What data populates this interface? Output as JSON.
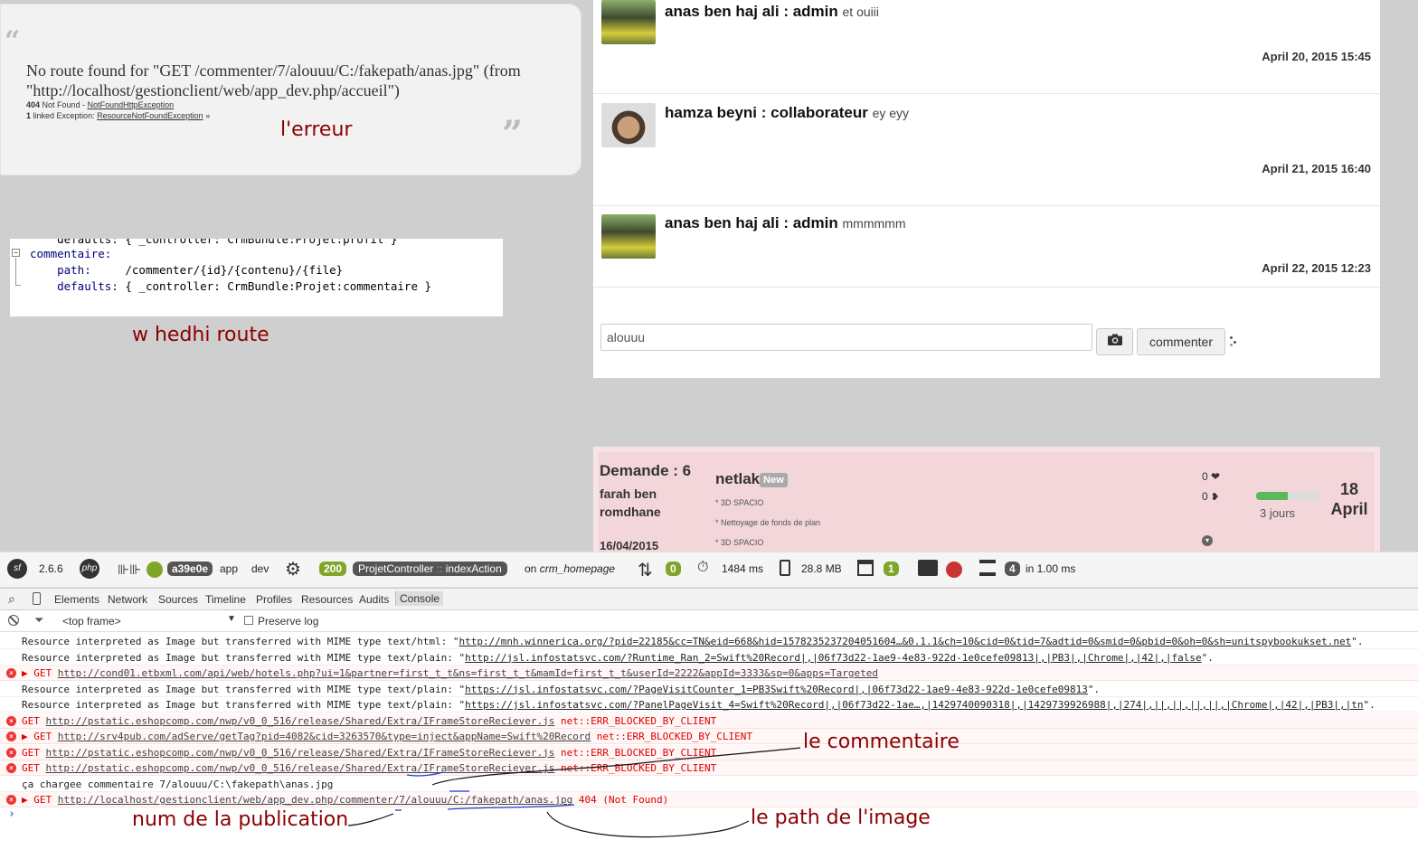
{
  "error_panel": {
    "message": "No route found for \"GET /commenter/7/alouuu/C:/fakepath/anas.jpg\" (from \"http://localhost/gestionclient/web/app_dev.php/accueil\")",
    "status_code": "404",
    "status_text": "Not Found - ",
    "exception1": "NotFoundHttpException",
    "linked_count": "1",
    "linked_label": "linked Exception:",
    "exception2": "ResourceNotFoundException",
    "chevron": "»",
    "annotation": "l'erreur"
  },
  "route_code": {
    "line0": "    defaults: { _controller: CrmBundle:Projet:profil }",
    "line1": "commentaire:",
    "line2_key": "    path:",
    "line2_val": "     /commenter/{id}/{contenu}/{file}",
    "line3_key": "    defaults:",
    "line3_val": " { _controller: CrmBundle:Projet:commentaire }",
    "annotation": "w hedhi route"
  },
  "comments": [
    {
      "author": "anas ben haj ali : admin",
      "text": "et ouiii",
      "date": "April 20, 2015 15:45"
    },
    {
      "author": "hamza beyni : collaborateur",
      "text": "ey eyy",
      "date": "April 21, 2015 16:40"
    },
    {
      "author": "anas ben haj ali : admin",
      "text": "mmmmmm",
      "date": "April 22, 2015 12:23"
    }
  ],
  "comment_form": {
    "input_value": "alouuu",
    "button_label": "commenter"
  },
  "demande": {
    "title": "Demande : 6",
    "client_line1": "farah ben",
    "client_line2": "romdhane",
    "date": "16/04/2015",
    "name": "netlak",
    "badge": "New",
    "items": [
      "* 3D SPACIO",
      "* Nettoyage de fonds de plan",
      "* 3D SPACIO"
    ],
    "likes": "0",
    "dislikes": "0",
    "progress": 0.5,
    "days_label": "3 jours",
    "day": "18",
    "month": "April"
  },
  "symfony_bar": {
    "version": "2.6.6",
    "php": "php",
    "token": "a39e0e",
    "env_app": "app",
    "env_dev": "dev",
    "status": "200",
    "controller": "ProjetController",
    "sep": "::",
    "action": "indexAction",
    "route_prefix": "on",
    "route": "crm_homepage",
    "ajax_count": "0",
    "time": "1484 ms",
    "memory": "28.8 MB",
    "logs_count": "1",
    "db_count": "4",
    "db_time": "in 1.00 ms"
  },
  "devtools": {
    "tabs": [
      "Elements",
      "Network",
      "Sources",
      "Timeline",
      "Profiles",
      "Resources",
      "Audits",
      "Console"
    ],
    "frame": "<top frame>",
    "preserve_log": "Preserve log",
    "prompt": "›",
    "rows": [
      {
        "type": "info",
        "text": "Resource interpreted as Image but transferred with MIME type text/html: \"",
        "url": "http://mnh.winnerica.org/?pid=22185&cc=TN&eid=668&hid=1578235237204051604…&0.1.1&ch=10&cid=0&tid=7&adtid=0&smid=0&pbid=0&oh=0&sh=unitspybookukset.net",
        "tail": "\"."
      },
      {
        "type": "info",
        "text": "Resource interpreted as Image but transferred with MIME type text/plain: \"",
        "url": "http://jsl.infostatsvc.com/?Runtime_Ran_2=Swift%20Record|,|06f73d22-1ae9-4e83-922d-1e0cefe09813|,|PB3|,|Chrome|,|42|,|false",
        "tail": "\"."
      },
      {
        "type": "err",
        "text": "▶ GET ",
        "url": "http://cond01.etbxml.com/api/web/hotels.php?ui=1&partner=first_t_t&ns=first_t_t&mamId=first_t_t&userId=2222&appId=3333&sp=0&apps=Targeted",
        "tail": ""
      },
      {
        "type": "info",
        "text": "Resource interpreted as Image but transferred with MIME type text/plain: \"",
        "url": "https://jsl.infostatsvc.com/?PageVisitCounter_1=PB3Swift%20Record|,|06f73d22-1ae9-4e83-922d-1e0cefe09813",
        "tail": "\"."
      },
      {
        "type": "info",
        "text": "Resource interpreted as Image but transferred with MIME type text/plain: \"",
        "url": "https://jsl.infostatsvc.com/?PanelPageVisit_4=Swift%20Record|,|06f73d22-1ae…,|1429740090318|,|1429739926988|,|274|,||,||,||,||,|Chrome|,|42|,|PB3|,|tn",
        "tail": "\"."
      },
      {
        "type": "err",
        "text": "GET ",
        "url": "http://pstatic.eshopcomp.com/nwp/v0_0_516/release/Shared/Extra/IFrameStoreReciever.js",
        "tail": " net::ERR_BLOCKED_BY_CLIENT"
      },
      {
        "type": "err",
        "text": "▶ GET ",
        "url": "http://srv4pub.com/adServe/getTag?pid=4082&cid=3263570&type=inject&appName=Swift%20Record",
        "tail": " net::ERR_BLOCKED_BY_CLIENT"
      },
      {
        "type": "err",
        "text": "GET ",
        "url": "http://pstatic.eshopcomp.com/nwp/v0_0_516/release/Shared/Extra/IFrameStoreReciever.js",
        "tail": " net::ERR_BLOCKED_BY_CLIENT"
      },
      {
        "type": "err",
        "text": "GET ",
        "url": "http://pstatic.eshopcomp.com/nwp/v0_0_516/release/Shared/Extra/IFrameStoreReciever.js",
        "tail": " net::ERR_BLOCKED_BY_CLIENT"
      },
      {
        "type": "info",
        "text": "ça chargee commentaire 7/alouuu/C:\\fakepath\\anas.jpg",
        "url": "",
        "tail": ""
      },
      {
        "type": "err",
        "text": "▶ GET ",
        "url": "http://localhost/gestionclient/web/app_dev.php/commenter/7/alouuu/C:/fakepath/anas.jpg",
        "tail": " 404 (Not Found)"
      }
    ]
  },
  "annotations": {
    "comment": "le commentaire",
    "pub_num": "num de la publication",
    "image_path": "le path de l'image"
  },
  "colors": {
    "error_red": "#dd0000",
    "symfony_green": "#7fa629",
    "annotation": "#8b0000",
    "demande_bg": "#f3d6d9"
  }
}
